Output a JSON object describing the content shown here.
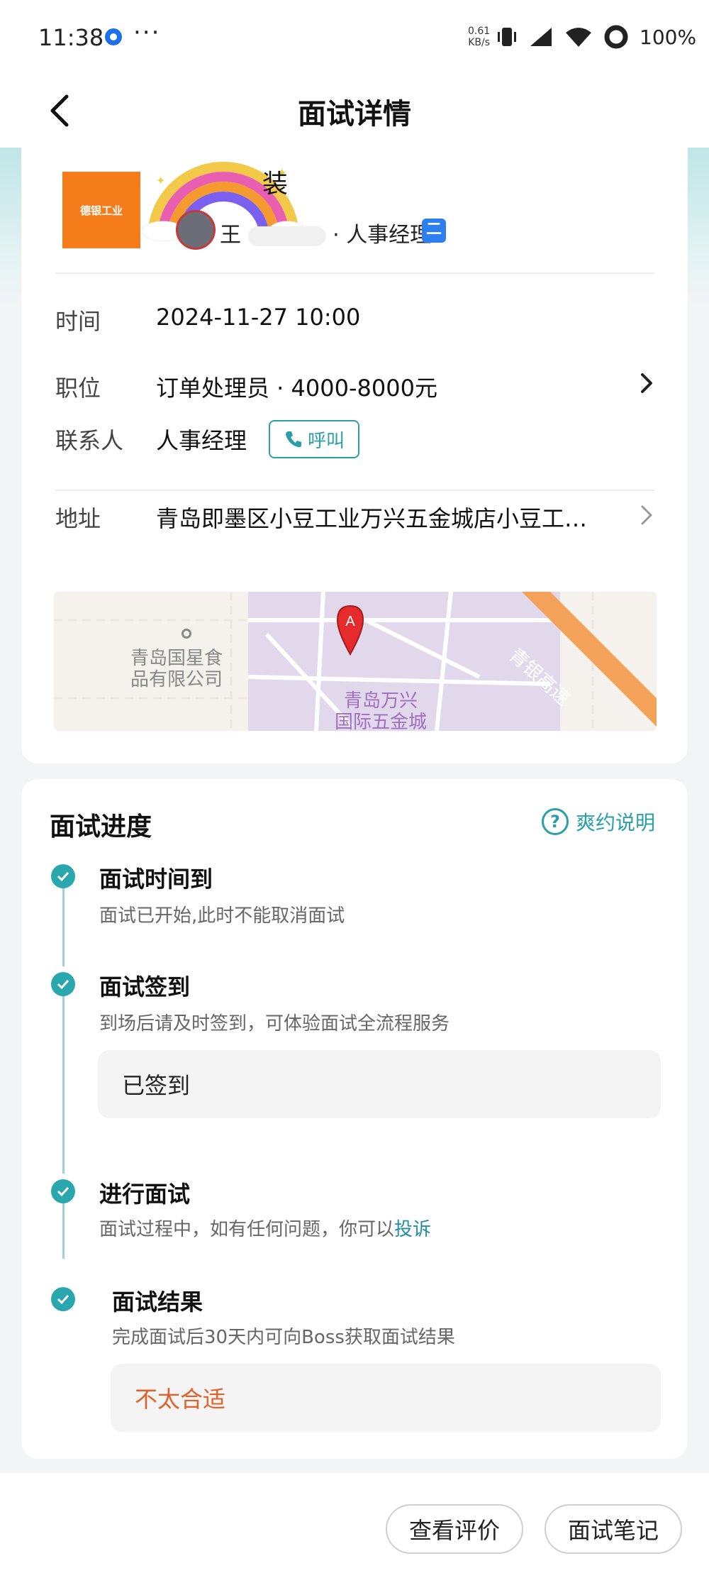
{
  "status_bar": {
    "time": "11:38",
    "more": "···",
    "net_speed_value": "0.61",
    "net_speed_unit": "KB/s",
    "battery": "100%",
    "icons": [
      "notification-icon",
      "vibrate-icon",
      "signal-icon",
      "wifi-icon",
      "battery-icon"
    ]
  },
  "header": {
    "title": "面试详情"
  },
  "company": {
    "logo_text": "德银工业",
    "name_suffix": "装",
    "contact_initial": "王",
    "contact_role": "人事经理",
    "badge": "二"
  },
  "details": {
    "time_label": "时间",
    "time_value": "2024-11-27 10:00",
    "position_label": "职位",
    "position_value": "订单处理员 · 4000-8000元",
    "contact_label": "联系人",
    "contact_value": "人事经理",
    "call_button": "呼叫",
    "address_label": "地址",
    "address_value": "青岛即墨区小豆工业万兴五金城店小豆工…"
  },
  "map": {
    "poi_1": "青岛国星食",
    "poi_1b": "品有限公司",
    "poi_2": "青岛万兴",
    "poi_2b": "国际五金城",
    "road": "青银高速",
    "pin_label": "A"
  },
  "progress": {
    "title": "面试进度",
    "help_text": "爽约说明",
    "steps": [
      {
        "title": "面试时间到",
        "desc": "面试已开始,此时不能取消面试"
      },
      {
        "title": "面试签到",
        "desc": "到场后请及时签到，可体验面试全流程服务",
        "box": "已签到"
      },
      {
        "title": "进行面试",
        "desc": "面试过程中，如有任何问题，你可以",
        "link": "投诉"
      },
      {
        "title": "面试结果",
        "desc": "完成面试后30天内可向Boss获取面试结果",
        "box": "不太合适"
      }
    ]
  },
  "bottom": {
    "review_button": "查看评价",
    "notes_button": "面试笔记"
  },
  "colors": {
    "accent": "#2aa7ad",
    "result": "#e2602a",
    "link": "#1f8fa0"
  }
}
